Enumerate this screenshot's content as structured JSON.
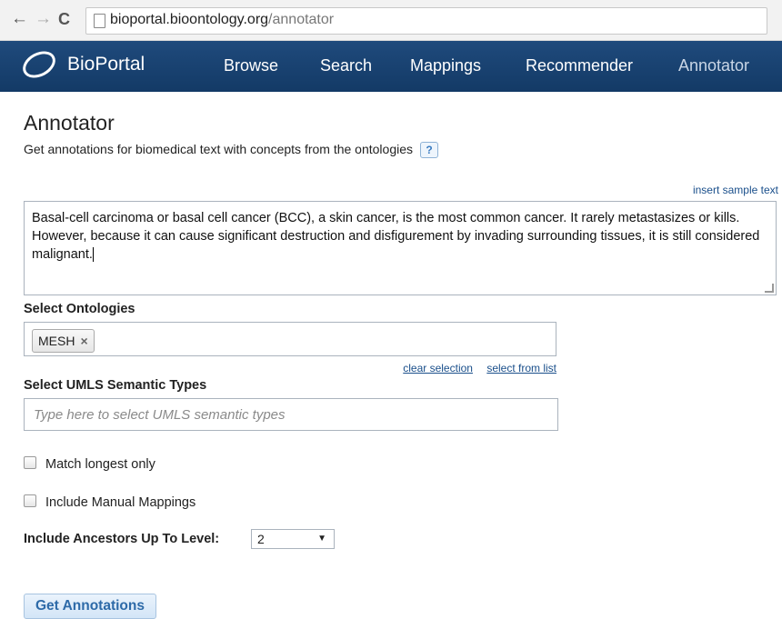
{
  "browser": {
    "url_host": "bioportal.bioontology.org",
    "url_path": "/annotator"
  },
  "navbar": {
    "brand": "BioPortal",
    "items": [
      "Browse",
      "Search",
      "Mappings",
      "Recommender",
      "Annotator"
    ],
    "active": "Annotator"
  },
  "page": {
    "title": "Annotator",
    "subtitle": "Get annotations for biomedical text with concepts from the ontologies",
    "help_label": "?",
    "insert_sample_link": "insert sample text",
    "text_input_value": "Basal-cell carcinoma or basal cell cancer (BCC), a skin cancer, is the most common cancer. It rarely metastasizes or kills. However, because it can cause significant destruction and disfigurement by invading surrounding tissues, it is still considered malignant."
  },
  "ontologies": {
    "label": "Select Ontologies",
    "selected": [
      "MESH"
    ],
    "clear_link": "clear selection",
    "list_link": "select from list"
  },
  "umls": {
    "label": "Select UMLS Semantic Types",
    "placeholder": "Type here to select UMLS semantic types"
  },
  "options": {
    "match_longest": "Match longest only",
    "manual_mappings": "Include Manual Mappings",
    "ancestors_label": "Include Ancestors Up To Level:",
    "ancestors_value": "2"
  },
  "submit_label": "Get Annotations"
}
